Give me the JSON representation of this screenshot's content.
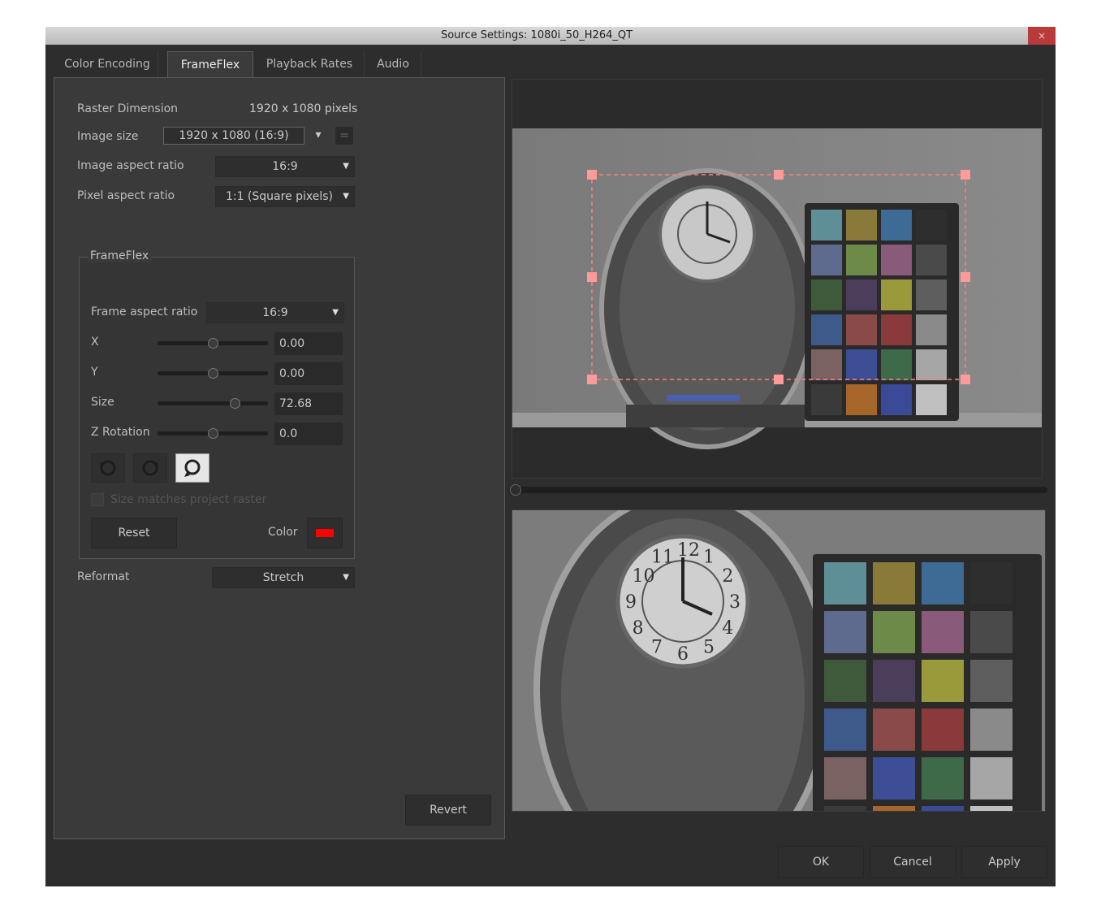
{
  "window": {
    "title": "Source Settings: 1080i_50_H264_QT",
    "close_label": "×"
  },
  "tabs": [
    {
      "label": "Color Encoding"
    },
    {
      "label": "FrameFlex"
    },
    {
      "label": "Playback Rates"
    },
    {
      "label": "Audio"
    }
  ],
  "settings": {
    "raster_label": "Raster Dimension",
    "raster_value": "1920 x 1080 pixels",
    "image_size_label": "Image size",
    "image_size_value": "1920 x 1080 (16:9)",
    "image_size_extra": "=",
    "image_aspect_label": "Image aspect ratio",
    "image_aspect_value": "16:9",
    "pixel_aspect_label": "Pixel aspect ratio",
    "pixel_aspect_value": "1:1 (Square pixels)"
  },
  "frameflex": {
    "group_title": "FrameFlex",
    "frame_aspect_label": "Frame aspect ratio",
    "frame_aspect_value": "16:9",
    "x_label": "X",
    "x_value": "0.00",
    "x_slider": 0.5,
    "y_label": "Y",
    "y_value": "0.00",
    "y_slider": 0.5,
    "size_label": "Size",
    "size_value": "72.68",
    "size_slider": 0.7,
    "zrot_label": "Z Rotation",
    "zrot_value": "0.0",
    "zrot_slider": 0.5,
    "checkbox_label": "Size matches project raster",
    "checkbox_checked": false,
    "reset_label": "Reset",
    "color_label": "Color",
    "color_swatch": "#ff0000"
  },
  "reformat": {
    "label": "Reformat",
    "value": "Stretch"
  },
  "buttons": {
    "revert": "Revert",
    "ok": "OK",
    "cancel": "Cancel",
    "apply": "Apply"
  },
  "icons": [
    "rotate-left-icon",
    "rotate-right-icon",
    "rotate-free-icon",
    "dropdown-arrow-icon"
  ],
  "overlay_color": "#ff8080",
  "chart_labels": {
    "clock_numerals": [
      "12",
      "1",
      "2",
      "3",
      "4",
      "5",
      "6",
      "7",
      "8",
      "9",
      "10",
      "11"
    ]
  }
}
